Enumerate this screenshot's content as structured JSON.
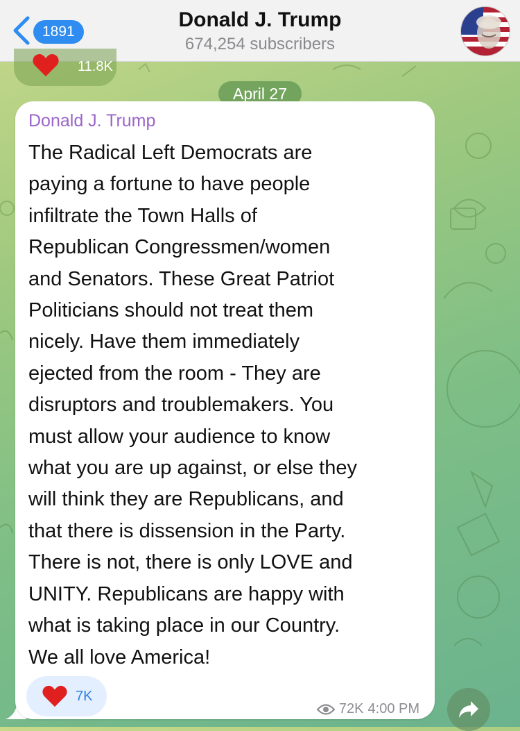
{
  "header": {
    "back_count": "1891",
    "title": "Donald J. Trump",
    "subtitle": "674,254 subscribers"
  },
  "previous_message": {
    "reaction_count": "11.8K"
  },
  "date_separator": "April 27",
  "message": {
    "sender": "Donald J. Trump",
    "lines": [
      "The Radical Left Democrats are",
      "paying a fortune to have people",
      "infiltrate the Town Halls of",
      "Republican Congressmen/women",
      "and Senators. These Great Patriot",
      "Politicians should not treat them",
      "nicely. Have them immediately",
      "ejected from the room - They are",
      "disruptors and troublemakers. You",
      "must allow your audience to know",
      "what you are up against, or else they",
      "will think they are Republicans, and",
      "that there is dissension in the Party.",
      "There is not, there is only LOVE and",
      "UNITY. Republicans are happy with",
      "what is taking place in our Country.",
      "We all love America!"
    ],
    "reaction_count": "7K",
    "views": "72K",
    "time": "4:00 PM"
  },
  "icons": {
    "back": "chevron-left-icon",
    "heart": "heart-icon",
    "eye": "eye-icon",
    "share": "share-arrow-icon"
  },
  "colors": {
    "accent": "#2f8cf0",
    "sender": "#9b65c9",
    "heart": "#e0201f",
    "bubble": "#ffffff"
  }
}
